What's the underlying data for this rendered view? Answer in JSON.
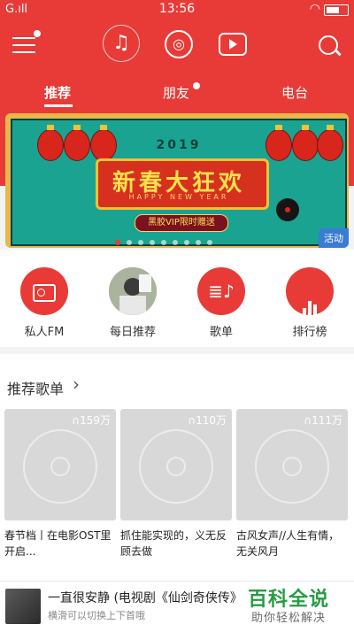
{
  "status_bar": {
    "carrier": "G.ıll",
    "time": "13:56",
    "wifi_icon": "wifi-icon",
    "battery_icon": "battery-icon"
  },
  "colors": {
    "accent": "#e83b37",
    "background": "#f2f3f5"
  },
  "header": {
    "icons": [
      "menu-icon",
      "music-note-icon",
      "netease-logo-icon",
      "video-play-icon",
      "search-icon"
    ]
  },
  "subtabs": [
    {
      "label": "推荐",
      "active": true
    },
    {
      "label": "朋友",
      "active": false,
      "badge": true
    },
    {
      "label": "电台",
      "active": false
    }
  ],
  "banner": {
    "year": "2019",
    "title": "新春大狂欢",
    "subtitle": "HAPPY NEW YEAR",
    "promo": "黑胶VIP限时赠送",
    "tag": "活动"
  },
  "quick_links": [
    {
      "label": "私人FM",
      "icon": "radio-icon"
    },
    {
      "label": "每日推荐",
      "icon": "daily-photo"
    },
    {
      "label": "歌单",
      "icon": "playlist-icon"
    },
    {
      "label": "排行榜",
      "icon": "chart-bars-icon"
    }
  ],
  "recommended": {
    "title": "推荐歌单",
    "playlists": [
      {
        "plays": "159万",
        "title": "春节档丨在电影OST里开启..."
      },
      {
        "plays": "110万",
        "title": "抓住能实现的，义无反顾去做"
      },
      {
        "plays": "111万",
        "title": "古风女声//人生有情，无关风月"
      }
    ]
  },
  "player": {
    "song": "一直很安静 (电视剧《仙剑奇侠传》",
    "hint": "横滑可以切换上下首哦"
  },
  "watermark": {
    "big": "百科全说",
    "small": "助你轻松解决"
  }
}
